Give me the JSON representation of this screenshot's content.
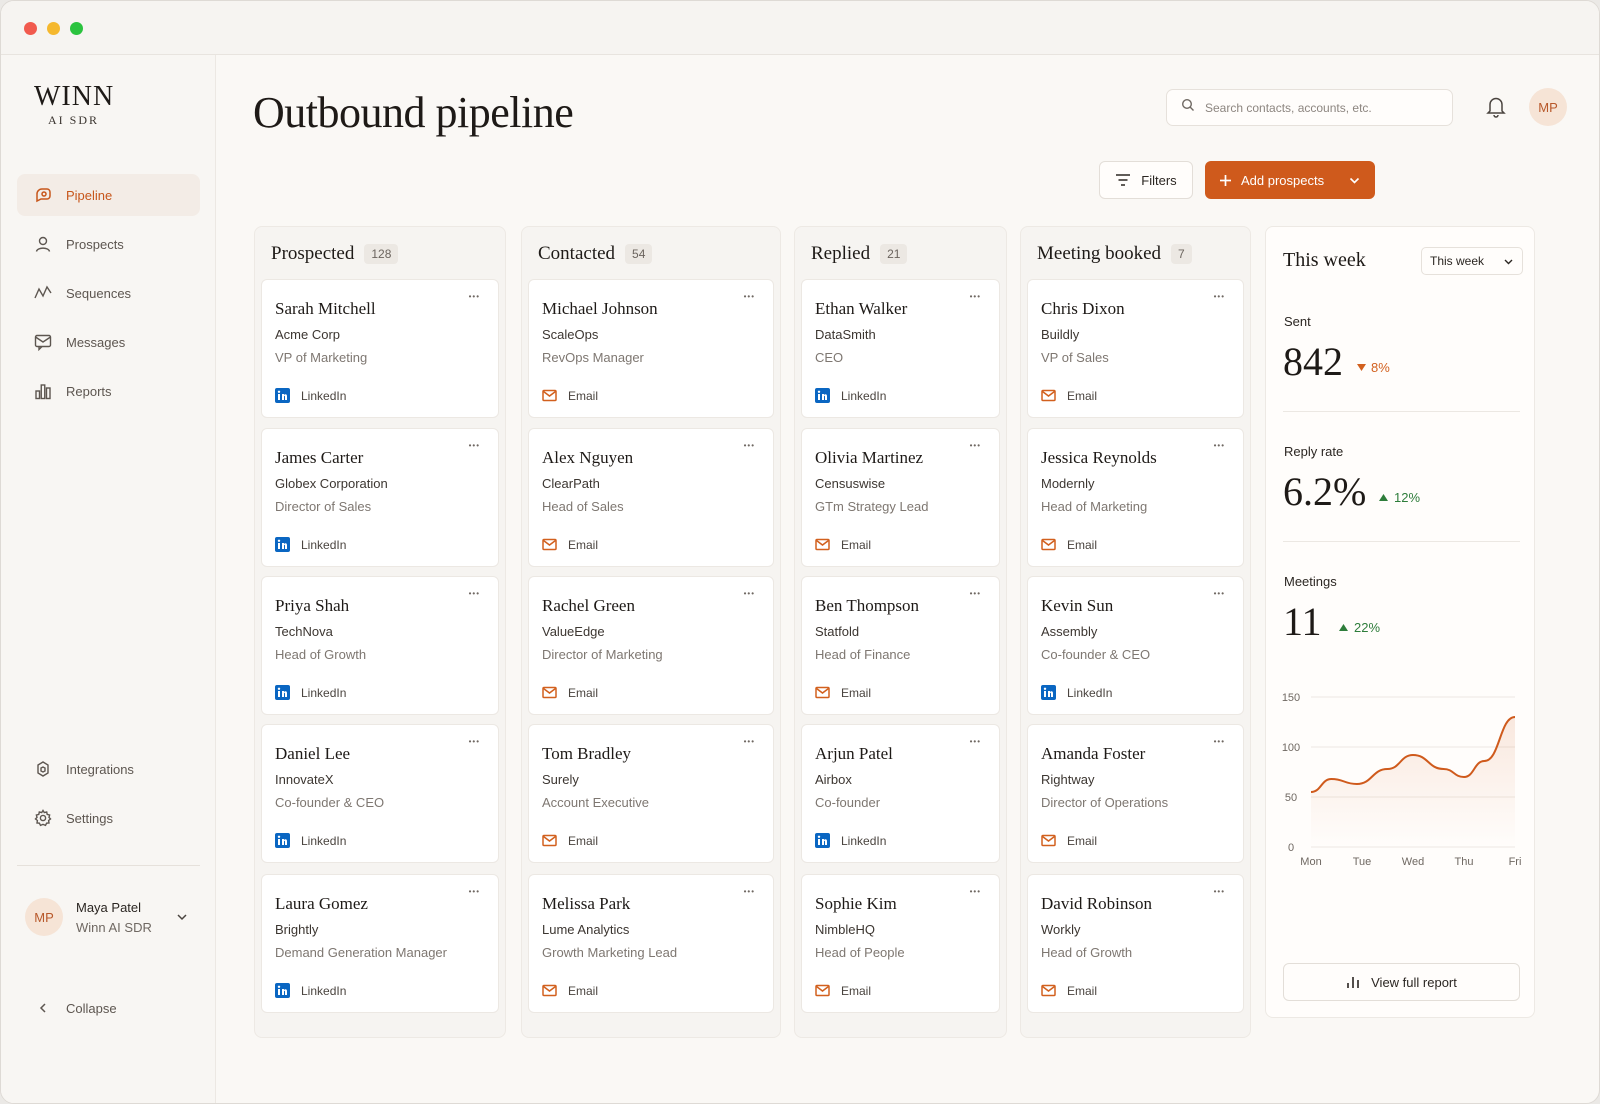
{
  "brand": {
    "name": "WINN",
    "tagline": "AI SDR"
  },
  "colors": {
    "accent": "#cf5a1c",
    "up": "#2e7d3b",
    "down": "#d2601e",
    "linkedin": "#0a66c2"
  },
  "sidebar": {
    "items": [
      {
        "label": "Pipeline",
        "icon": "pipeline-icon",
        "active": true
      },
      {
        "label": "Prospects",
        "icon": "user-icon",
        "active": false
      },
      {
        "label": "Sequences",
        "icon": "sequences-icon",
        "active": false
      },
      {
        "label": "Messages",
        "icon": "message-icon",
        "active": false
      },
      {
        "label": "Reports",
        "icon": "bar-chart-icon",
        "active": false
      }
    ],
    "bottom_items": [
      {
        "label": "Integrations",
        "icon": "integrations-icon"
      },
      {
        "label": "Settings",
        "icon": "gear-icon"
      }
    ],
    "user": {
      "initials": "MP",
      "name": "Maya Patel",
      "org": "Winn AI SDR"
    },
    "collapse_label": "Collapse"
  },
  "header": {
    "title": "Outbound pipeline",
    "search_placeholder": "Search contacts, accounts, etc.",
    "avatar_initials": "MP",
    "filters_label": "Filters",
    "add_label": "Add prospects"
  },
  "columns": [
    {
      "title": "Prospected",
      "count": "128",
      "cards": [
        {
          "name": "Sarah Mitchell",
          "company": "Acme Corp",
          "role": "VP of Marketing",
          "channel": "LinkedIn"
        },
        {
          "name": "James Carter",
          "company": "Globex Corporation",
          "role": "Director of Sales",
          "channel": "LinkedIn"
        },
        {
          "name": "Priya Shah",
          "company": "TechNova",
          "role": "Head of Growth",
          "channel": "LinkedIn"
        },
        {
          "name": "Daniel Lee",
          "company": "InnovateX",
          "role": "Co-founder & CEO",
          "channel": "LinkedIn"
        },
        {
          "name": "Laura Gomez",
          "company": "Brightly",
          "role": "Demand Generation Manager",
          "channel": "LinkedIn"
        }
      ]
    },
    {
      "title": "Contacted",
      "count": "54",
      "cards": [
        {
          "name": "Michael Johnson",
          "company": "ScaleOps",
          "role": "RevOps Manager",
          "channel": "Email"
        },
        {
          "name": "Alex Nguyen",
          "company": "ClearPath",
          "role": "Head of Sales",
          "channel": "Email"
        },
        {
          "name": "Rachel Green",
          "company": "ValueEdge",
          "role": "Director of Marketing",
          "channel": "Email"
        },
        {
          "name": "Tom Bradley",
          "company": "Surely",
          "role": "Account Executive",
          "channel": "Email"
        },
        {
          "name": "Melissa Park",
          "company": "Lume Analytics",
          "role": "Growth Marketing Lead",
          "channel": "Email"
        }
      ]
    },
    {
      "title": "Replied",
      "count": "21",
      "cards": [
        {
          "name": "Ethan Walker",
          "company": "DataSmith",
          "role": "CEO",
          "channel": "LinkedIn"
        },
        {
          "name": "Olivia Martinez",
          "company": "Censuswise",
          "role": "GTm Strategy Lead",
          "channel": "Email"
        },
        {
          "name": "Ben Thompson",
          "company": "Statfold",
          "role": "Head of Finance",
          "channel": "Email"
        },
        {
          "name": "Arjun Patel",
          "company": "Airbox",
          "role": "Co-founder",
          "channel": "LinkedIn"
        },
        {
          "name": "Sophie Kim",
          "company": "NimbleHQ",
          "role": "Head of People",
          "channel": "Email"
        }
      ]
    },
    {
      "title": "Meeting booked",
      "count": "7",
      "cards": [
        {
          "name": "Chris Dixon",
          "company": "Buildly",
          "role": "VP of Sales",
          "channel": "Email"
        },
        {
          "name": "Jessica Reynolds",
          "company": "Modernly",
          "role": "Head of Marketing",
          "channel": "Email"
        },
        {
          "name": "Kevin Sun",
          "company": "Assembly",
          "role": "Co-founder & CEO",
          "channel": "LinkedIn"
        },
        {
          "name": "Amanda Foster",
          "company": "Rightway",
          "role": "Director of Operations",
          "channel": "Email"
        },
        {
          "name": "David Robinson",
          "company": "Workly",
          "role": "Head of Growth",
          "channel": "Email"
        }
      ]
    }
  ],
  "week": {
    "title": "This week",
    "range_selected": "This week",
    "stats": [
      {
        "label": "Sent",
        "value": "842",
        "delta": "8%",
        "direction": "down"
      },
      {
        "label": "Reply rate",
        "value": "6.2%",
        "delta": "12%",
        "direction": "up"
      },
      {
        "label": "Meetings",
        "value": "11",
        "delta": "22%",
        "direction": "up"
      }
    ],
    "report_label": "View full report"
  },
  "chart_data": {
    "type": "line",
    "x": [
      "Mon",
      "Tue",
      "Wed",
      "Thu",
      "Fri"
    ],
    "y_ticks": [
      "150",
      "100",
      "50",
      "0"
    ],
    "ylim": [
      0,
      150
    ],
    "series": [
      {
        "x": [
          0,
          0.4,
          0.9,
          1.5,
          2.0,
          2.6,
          3.0,
          3.4,
          4.0
        ],
        "values": [
          55,
          68,
          63,
          78,
          92,
          78,
          70,
          86,
          130
        ]
      }
    ],
    "grid": true
  }
}
